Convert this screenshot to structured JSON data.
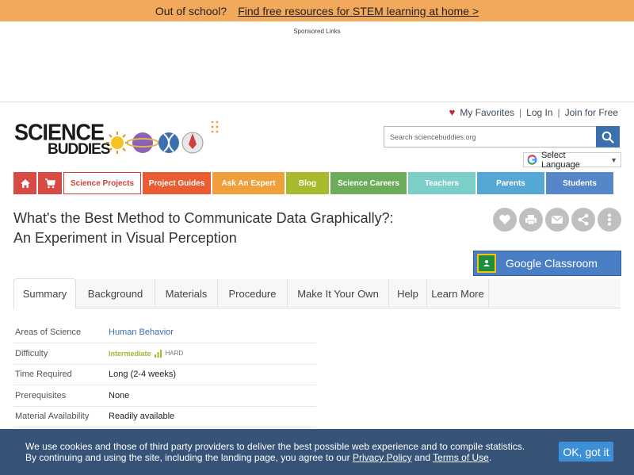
{
  "promo": {
    "lead": "Out of school?",
    "link": "Find free resources for STEM learning at home  >"
  },
  "ads": {
    "label": "Sponsored Links"
  },
  "user_links": {
    "favorites": "My Favorites",
    "login": "Log In",
    "join": "Join for Free",
    "separator": "|"
  },
  "logo": {
    "line1": "SCIENCE",
    "line2": "BUDDIES"
  },
  "search": {
    "placeholder": "Search sciencebuddies.org"
  },
  "translate": {
    "label": "Select Language"
  },
  "nav": {
    "science_projects": "Science Projects",
    "project_guides": "Project Guides",
    "ask_an_expert": "Ask An Expert",
    "blog": "Blog",
    "science_careers": "Science Careers",
    "teachers": "Teachers",
    "parents": "Parents",
    "students": "Students"
  },
  "page": {
    "title_line1": "What's the Best Method to Communicate Data Graphically?:",
    "title_line2": "An Experiment in Visual Perception"
  },
  "google_classroom": {
    "label": "Google Classroom"
  },
  "tabs": [
    "Summary",
    "Background",
    "Materials",
    "Procedure",
    "Make It Your Own",
    "Help",
    "Learn More"
  ],
  "details": {
    "areas_label": "Areas of Science",
    "areas_value": "Human Behavior",
    "difficulty_label": "Difficulty",
    "difficulty_value": "Intermediate",
    "difficulty_max": "HARD",
    "time_label": "Time Required",
    "time_value": "Long (2-4 weeks)",
    "prereq_label": "Prerequisites",
    "prereq_value": "None",
    "material_label": "Material Availability",
    "material_value": "Readily available"
  },
  "cookie": {
    "line1": "We use cookies and those of third party providers to deliver the best possible web experience and to compile statistics.",
    "line2_pre": "By continuing and using the site, including the landing page, you agree to our ",
    "privacy": "Privacy Policy",
    "and": " and ",
    "terms": "Terms of Use",
    "end": ".",
    "ok": "OK, got it"
  },
  "colors": {
    "promo_bg": "#f3a95b",
    "brand_blue": "#3b6fad",
    "cookie_bg": "#2b4970",
    "difficulty": "#a6b72a"
  }
}
